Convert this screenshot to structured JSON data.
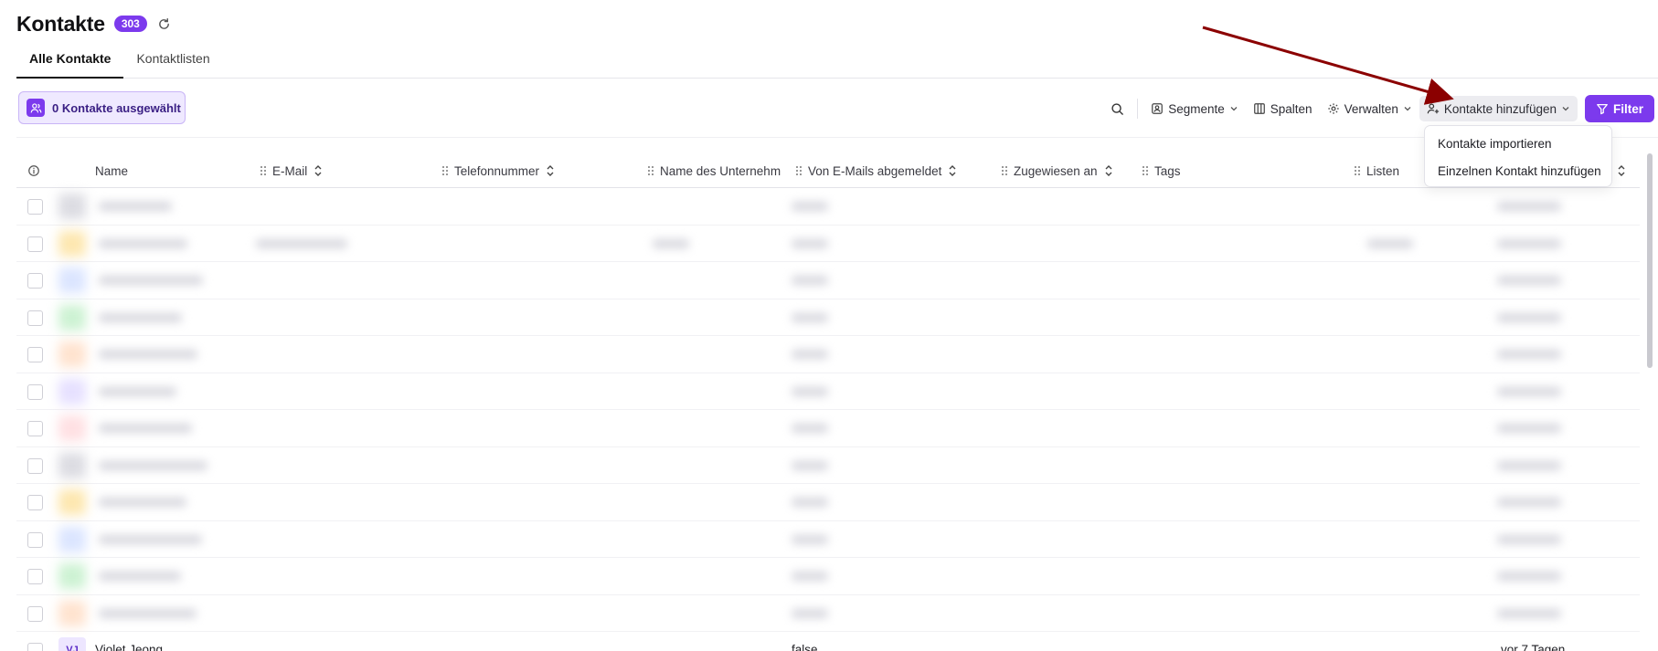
{
  "header": {
    "title": "Kontakte",
    "count": "303",
    "refresh_icon": "refresh-icon"
  },
  "tabs": [
    {
      "label": "Alle Kontakte",
      "active": true
    },
    {
      "label": "Kontaktlisten",
      "active": false
    }
  ],
  "selection": {
    "label": "0 Kontakte ausgewählt",
    "icon": "users-icon"
  },
  "toolbar": {
    "search_icon": "search-icon",
    "segments_label": "Segmente",
    "columns_label": "Spalten",
    "manage_label": "Verwalten",
    "add_contacts_label": "Kontakte hinzufügen",
    "filter_label": "Filter"
  },
  "dropdown": {
    "items": [
      {
        "label": "Kontakte importieren"
      },
      {
        "label": "Einzelnen Kontakt hinzufügen"
      }
    ]
  },
  "table": {
    "columns": [
      {
        "label": "Name"
      },
      {
        "label": "E-Mail"
      },
      {
        "label": "Telefonnummer"
      },
      {
        "label": "Name des Unternehm"
      },
      {
        "label": "Von E-Mails abgemeldet"
      },
      {
        "label": "Zugewiesen an"
      },
      {
        "label": "Tags"
      },
      {
        "label": "Listen"
      }
    ],
    "last_row": {
      "initials": "VJ",
      "name": "Violet Jeong",
      "unsubscribed": "false",
      "created": "vor 7 Tagen"
    }
  },
  "colors": {
    "accent": "#7c3aed",
    "annotation_arrow": "#8b0000"
  }
}
